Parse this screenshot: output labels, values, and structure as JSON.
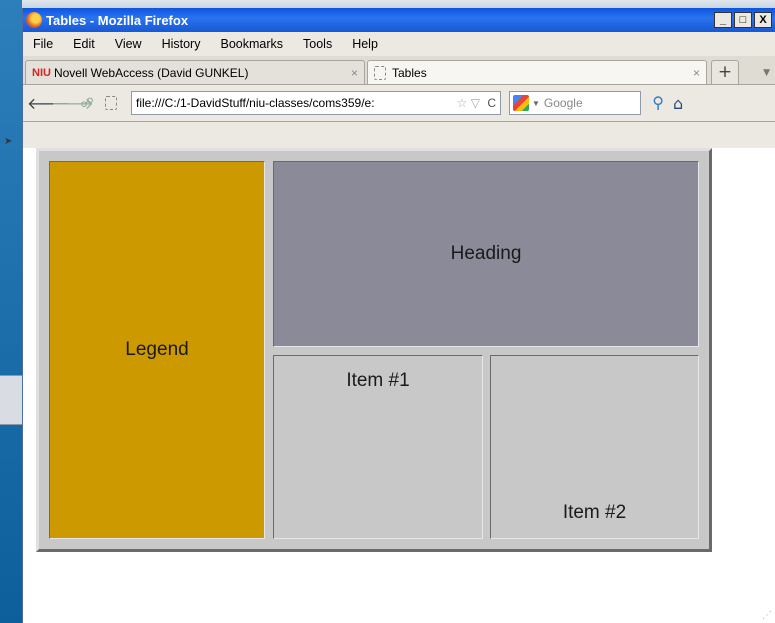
{
  "window": {
    "title": "Tables - Mozilla Firefox",
    "minimize": "_",
    "maximize": "□",
    "close": "X"
  },
  "menu": [
    "File",
    "Edit",
    "View",
    "History",
    "Bookmarks",
    "Tools",
    "Help"
  ],
  "tabs": [
    {
      "badge": "NIU",
      "label": "Novell WebAccess (David GUNKEL)",
      "close": "×"
    },
    {
      "label": "Tables",
      "close": "×"
    }
  ],
  "new_tab": "+",
  "nav": {
    "url": "file:///C:/1-DavidStuff/niu-classes/coms359/e:",
    "search_placeholder": "Google"
  },
  "table": {
    "legend": "Legend",
    "heading": "Heading",
    "item1": "Item #1",
    "item2": "Item #2"
  },
  "colors": {
    "legend_bg": "#cc9900",
    "heading_bg": "#8a8a99",
    "item_bg": "#c8c8c8"
  }
}
